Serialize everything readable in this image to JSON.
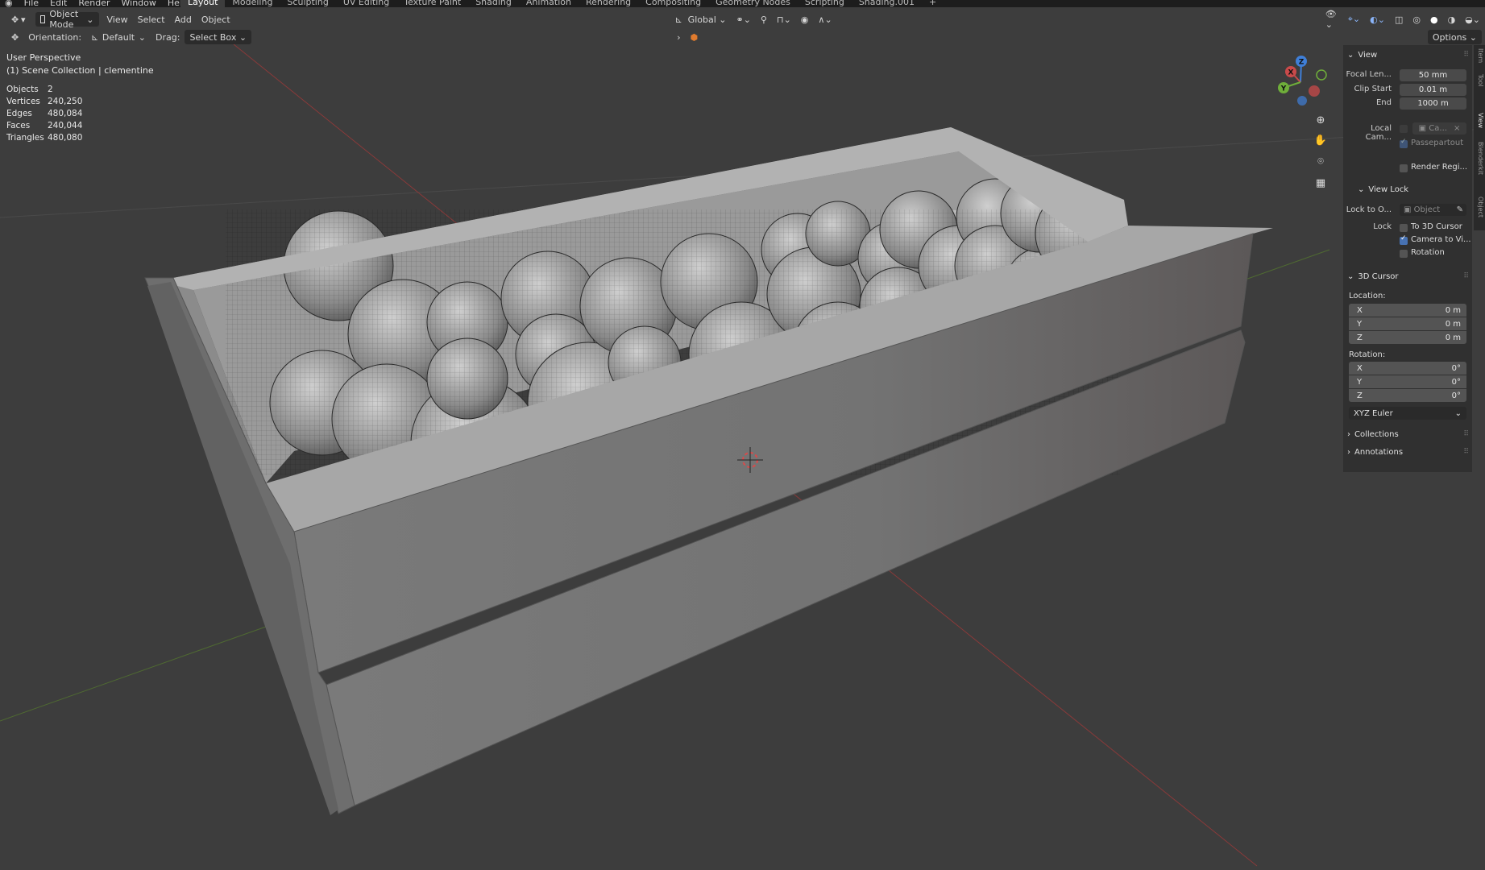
{
  "topbar": {
    "menus": [
      "File",
      "Edit",
      "Render",
      "Window",
      "Help"
    ],
    "tabs": [
      "Layout",
      "Modeling",
      "Sculpting",
      "UV Editing",
      "Texture Paint",
      "Shading",
      "Animation",
      "Rendering",
      "Compositing",
      "Geometry Nodes",
      "Scripting",
      "Shading.001"
    ],
    "active_tab": "Layout",
    "add_tab": "+"
  },
  "header": {
    "mode": "Object Mode",
    "menus": [
      "View",
      "Select",
      "Add",
      "Object"
    ],
    "transform_orientation": "Global"
  },
  "tool_settings": {
    "orientation_label": "Orientation:",
    "orientation_value": "Default",
    "drag_label": "Drag:",
    "drag_value": "Select Box",
    "options": "Options"
  },
  "overlay": {
    "view_name": "User Perspective",
    "collection": "(1) Scene Collection | clementine",
    "stats": [
      {
        "label": "Objects",
        "value": "2"
      },
      {
        "label": "Vertices",
        "value": "240,250"
      },
      {
        "label": "Edges",
        "value": "480,084"
      },
      {
        "label": "Faces",
        "value": "240,044"
      },
      {
        "label": "Triangles",
        "value": "480,080"
      }
    ]
  },
  "gizmo": {
    "x": "X",
    "y": "Y",
    "z": "Z"
  },
  "npanel": {
    "tabs": [
      "Item",
      "Tool",
      "View",
      "Blenderkit",
      "Object"
    ],
    "view": {
      "title": "View",
      "focal_label": "Focal Len...",
      "focal_value": "50 mm",
      "clip_start_label": "Clip Start",
      "clip_start_value": "0.01 m",
      "end_label": "End",
      "end_value": "1000 m",
      "local_cam_label": "Local Cam...",
      "local_cam_value": "Ca...",
      "passepartout": "Passepartout",
      "render_region": "Render Regi..."
    },
    "view_lock": {
      "title": "View Lock",
      "lock_to_label": "Lock to O...",
      "lock_to_placeholder": "Object",
      "lock_label": "Lock",
      "to_cursor": "To 3D Cursor",
      "camera_to_view": "Camera to Vi...",
      "rotation": "Rotation"
    },
    "cursor": {
      "title": "3D Cursor",
      "location_label": "Location:",
      "location": [
        {
          "axis": "X",
          "value": "0 m"
        },
        {
          "axis": "Y",
          "value": "0 m"
        },
        {
          "axis": "Z",
          "value": "0 m"
        }
      ],
      "rotation_label": "Rotation:",
      "rotation": [
        {
          "axis": "X",
          "value": "0°"
        },
        {
          "axis": "Y",
          "value": "0°"
        },
        {
          "axis": "Z",
          "value": "0°"
        }
      ],
      "rotation_mode": "XYZ Euler"
    },
    "collections": "Collections",
    "annotations": "Annotations"
  },
  "colors": {
    "axis_x": "#c94a4a",
    "axis_y": "#6fae3a",
    "axis_z": "#3f7fd8",
    "accent": "#4772b3",
    "viewport_bg": "#3d3d3d"
  }
}
